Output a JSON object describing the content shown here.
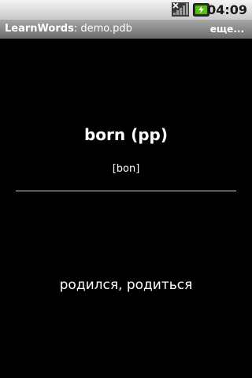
{
  "status_bar": {
    "time": "04:09",
    "icons": [
      "signal-no-service-icon",
      "battery-charging-icon"
    ]
  },
  "title_bar": {
    "app_name": "LearnWords",
    "separator": ": ",
    "file_name": "demo.pdb",
    "more_label": "еще..."
  },
  "card": {
    "word": "born (pp)",
    "transcription": "[bon]",
    "translation": "родился, родиться"
  },
  "colors": {
    "background": "#000000",
    "text": "#ffffff",
    "title_bar": "#8a8a8a",
    "status_bar": "#dcdcdc",
    "battery_accent": "#55c10f"
  }
}
